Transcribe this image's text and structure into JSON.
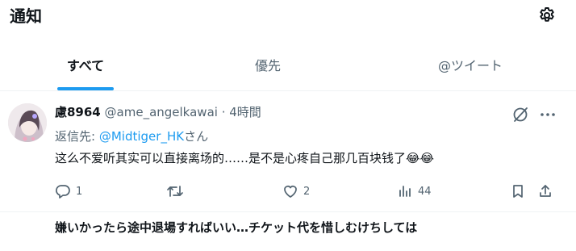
{
  "header": {
    "title": "通知",
    "settings_icon": "gear-icon"
  },
  "tabs": [
    {
      "label": "すべて",
      "active": true
    },
    {
      "label": "優先",
      "active": false
    },
    {
      "label": "@ツイート",
      "active": false
    }
  ],
  "tweet": {
    "display_name": "慮8964",
    "handle": "@ame_angelkawai",
    "separator": "·",
    "time": "4時間",
    "reply_prefix": "返信先:",
    "reply_to": "@Midtiger_HK",
    "reply_suffix": "さん",
    "text": "这么不爱听其实可以直接离场的……是不是心疼自己那几百块钱了😂😂",
    "actions": {
      "reply_count": "1",
      "retweet_count": "",
      "like_count": "2",
      "view_count": "44"
    }
  },
  "next_tweet": {
    "text": "嫌いかったら途中退場すればいい…チケット代を惜しむけちしては"
  },
  "colors": {
    "accent": "#1d9bf0",
    "text_primary": "#0f1419",
    "text_secondary": "#536471",
    "divider": "#eff3f4"
  }
}
